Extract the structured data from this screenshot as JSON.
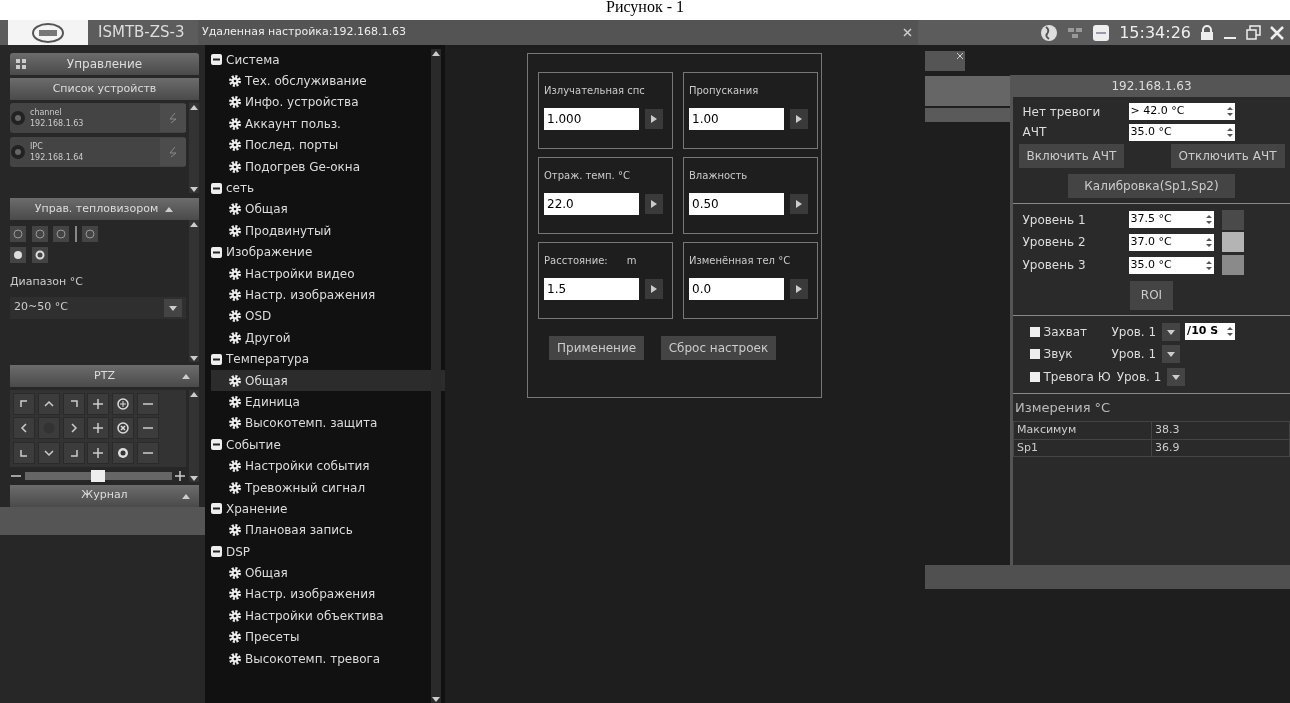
{
  "caption": "Рисунок - 1",
  "titlebar": {
    "app_title": "ISMTB-ZS-3",
    "dialog_title": "Удаленная настройка:192.168.1.63",
    "time": "15:34:26"
  },
  "left_panel": {
    "header": "Управление",
    "device_list": {
      "title": "Список устройств",
      "devices": [
        {
          "name": "channel",
          "ip": "192.168.1.63"
        },
        {
          "name": "IPC",
          "ip": "192.168.1.64"
        }
      ]
    },
    "thermal": {
      "title": "Управ. тепловизором",
      "range_label": "Диапазон °C",
      "range_value": "20~50 °C"
    },
    "ptz": {
      "title": "PTZ",
      "level": 0.5
    },
    "log": {
      "title": "Журнал"
    }
  },
  "tree": [
    {
      "label": "Система",
      "expanded": true,
      "children": [
        {
          "label": "Тех. обслуживание",
          "selected": false
        },
        {
          "label": "Инфо. устройства",
          "selected": false
        },
        {
          "label": "Аккаунт польз.",
          "selected": false
        },
        {
          "label": "Послед. порты",
          "selected": false
        },
        {
          "label": "Подогрев Ge-окна",
          "selected": false
        }
      ]
    },
    {
      "label": "сеть",
      "expanded": true,
      "children": [
        {
          "label": "Общая",
          "selected": false
        },
        {
          "label": "Продвинутый",
          "selected": false
        }
      ]
    },
    {
      "label": "Изображение",
      "expanded": true,
      "children": [
        {
          "label": "Настройки видео",
          "selected": false
        },
        {
          "label": "Настр. изображения",
          "selected": false
        },
        {
          "label": "OSD",
          "selected": false
        },
        {
          "label": "Другой",
          "selected": false
        }
      ]
    },
    {
      "label": "Температура",
      "expanded": true,
      "children": [
        {
          "label": "Общая",
          "selected": true
        },
        {
          "label": "Единица",
          "selected": false
        },
        {
          "label": "Высокотемп. защита",
          "selected": false
        }
      ]
    },
    {
      "label": "Событие",
      "expanded": true,
      "children": [
        {
          "label": "Настройки события",
          "selected": false
        },
        {
          "label": "Тревожный сигнал",
          "selected": false
        }
      ]
    },
    {
      "label": "Хранение",
      "expanded": true,
      "children": [
        {
          "label": "Плановая запись",
          "selected": false
        }
      ]
    },
    {
      "label": "DSP",
      "expanded": true,
      "children": [
        {
          "label": "Общая",
          "selected": false
        },
        {
          "label": "Настр. изображения",
          "selected": false
        },
        {
          "label": "Настройки объектива",
          "selected": false
        },
        {
          "label": "Пресеты",
          "selected": false
        },
        {
          "label": "Высокотемп. тревога",
          "selected": false
        }
      ]
    }
  ],
  "form": {
    "fields": [
      {
        "label": "Излучательная спс",
        "value": "1.000"
      },
      {
        "label": "Пропускания",
        "value": "1.00"
      },
      {
        "label": "Отраж. темп. °C",
        "value": "22.0"
      },
      {
        "label": "Влажность",
        "value": "0.50"
      },
      {
        "label": "Расстояние:      m",
        "value": "1.5"
      },
      {
        "label": "Изменённая тел °C",
        "value": "0.0"
      }
    ],
    "buttons": [
      "Применение",
      "Сброс настроек"
    ]
  },
  "right_panel": {
    "title": "192.168.1.63",
    "thresholds": [
      {
        "label": "Нет тревоги",
        "value": "> 42.0 °C"
      },
      {
        "label": "АЧТ",
        "value": "35.0 °C"
      }
    ],
    "buttons": [
      "Включить АЧТ",
      "Отключить АЧТ"
    ],
    "calibrate": "Калибровка(Sp1,Sp2)",
    "levels": [
      {
        "label": "Уровень 1",
        "value": "37.5 °C",
        "color": "#4a4a4a"
      },
      {
        "label": "Уровень 2",
        "value": "37.0 °C",
        "color": "#b4b4b4"
      },
      {
        "label": "Уровень 3",
        "value": "35.0 °C",
        "color": "#8a8a8a"
      }
    ],
    "roi": "ROI",
    "actions": [
      {
        "label": "Захват",
        "checked": false,
        "level": "Уров. 1",
        "interval": "/10 S"
      },
      {
        "label": "Звук",
        "checked": false,
        "level": "Уров. 1"
      },
      {
        "label": "Тревога Ю",
        "checked": false,
        "level": "Уров. 1"
      }
    ],
    "measurements": {
      "title": "Измерения °C",
      "rows": [
        [
          "Максимум",
          "38.3"
        ],
        [
          "Sp1",
          "36.9"
        ]
      ]
    }
  }
}
